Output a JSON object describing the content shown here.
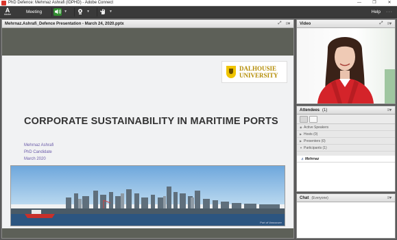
{
  "window": {
    "title": "PhD Defence: Mehrnaz Ashrafi (IDPHD) - Adobe Connect",
    "controls": [
      "—",
      "❐",
      "✕"
    ]
  },
  "menubar": {
    "logo_text": "Adobe",
    "meeting_label": "Meeting",
    "help_label": "Help",
    "more": "···"
  },
  "share_pod": {
    "title": "Mehrnaz.Ashrafi_Defence Presentation - March 24, 2020.pptx",
    "fullscreen_icon": "⤢",
    "menu_icon": "≡▾",
    "slide": {
      "university_line1": "DALHOUSIE",
      "university_line2": "UNIVERSITY",
      "heading": "CORPORATE SUSTAINABILITY IN MARITIME PORTS",
      "author": "Mehrnaz Ashrafi",
      "role": "PhD Candidate",
      "date": "March 2020",
      "photo_credit": "Port of Vancouver"
    }
  },
  "video_pod": {
    "title": "Video",
    "popout_icon": "⤢",
    "menu_icon": "≡▾"
  },
  "attendees_pod": {
    "title": "Attendees",
    "count": "(1)",
    "menu_icon": "≡▾",
    "active_speakers": "Active Speakers",
    "hosts": "Hosts (0)",
    "presenters": "Presenters (0)",
    "participants": "Participants (1)",
    "participant_name": "Mehrnaz"
  },
  "chat_pod": {
    "title": "Chat",
    "scope": "(Everyone)",
    "menu_icon": "≡▾"
  }
}
